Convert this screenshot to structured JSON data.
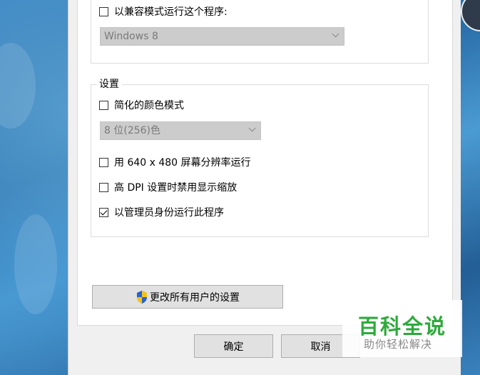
{
  "compatibility": {
    "run_compat_label": "以兼容模式运行这个程序:",
    "run_compat_checked": false,
    "os_select_value": "Windows 8"
  },
  "settings": {
    "group_label": "设置",
    "reduced_color_label": "简化的颜色模式",
    "reduced_color_checked": false,
    "color_select_value": "8 位(256)色",
    "res_640_label": "用 640 x 480 屏幕分辨率运行",
    "res_640_checked": false,
    "high_dpi_label": "高 DPI 设置时禁用显示缩放",
    "high_dpi_checked": false,
    "admin_label": "以管理员身份运行此程序",
    "admin_checked": true
  },
  "change_all_users_label": "更改所有用户的设置",
  "footer": {
    "ok_label": "确定",
    "cancel_label": "取消"
  },
  "watermark": {
    "brand": "百科全说",
    "sub": "助你轻松解决"
  },
  "colors": {
    "dialog_bg": "#f0f0f0",
    "disabled_select_bg": "#cccccc",
    "watermark_green": "#2eaa3c"
  }
}
